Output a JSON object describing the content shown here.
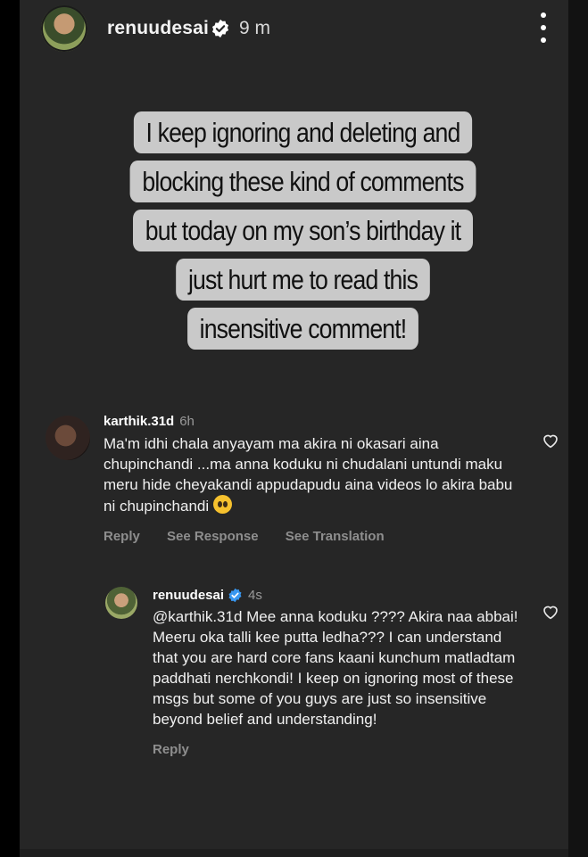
{
  "header": {
    "username": "renuudesai",
    "time": "9 m"
  },
  "story": {
    "lines": [
      "I keep ignoring and deleting and",
      "blocking these kind of comments",
      "but today on my son’s birthday it",
      "just hurt me to read this",
      "insensitive comment!"
    ]
  },
  "comment": {
    "username": "karthik.31d",
    "time": "6h",
    "text": "Ma'm idhi chala anyayam ma akira ni okasari aina chupinchandi ...ma anna koduku ni chudalani untundi maku meru hide cheyakandi appudapudu aina videos lo akira babu ni chupinchandi",
    "actions": {
      "reply": "Reply",
      "see_response": "See Response",
      "see_translation": "See Translation"
    },
    "emoji": "pleading-face-emoji"
  },
  "reply": {
    "username": "renuudesai",
    "time": "4s",
    "text": "@karthik.31d Mee anna koduku ???? Akira naa abbai! Meeru oka talli kee putta ledha??? I can understand that you are hard core fans kaani kunchum matladtam paddhati nerchkondi! I keep on ignoring most of these msgs but some of you guys are just so insensitive beyond belief and understanding!",
    "actions": {
      "reply": "Reply"
    }
  },
  "colors": {
    "background": "#262626",
    "overlay_box": "#c9c9c9",
    "verified_blue": "#3897f0",
    "muted_text": "#8e8e8e"
  },
  "icons": [
    "verified-badge-icon",
    "more-options-icon",
    "heart-icon"
  ]
}
